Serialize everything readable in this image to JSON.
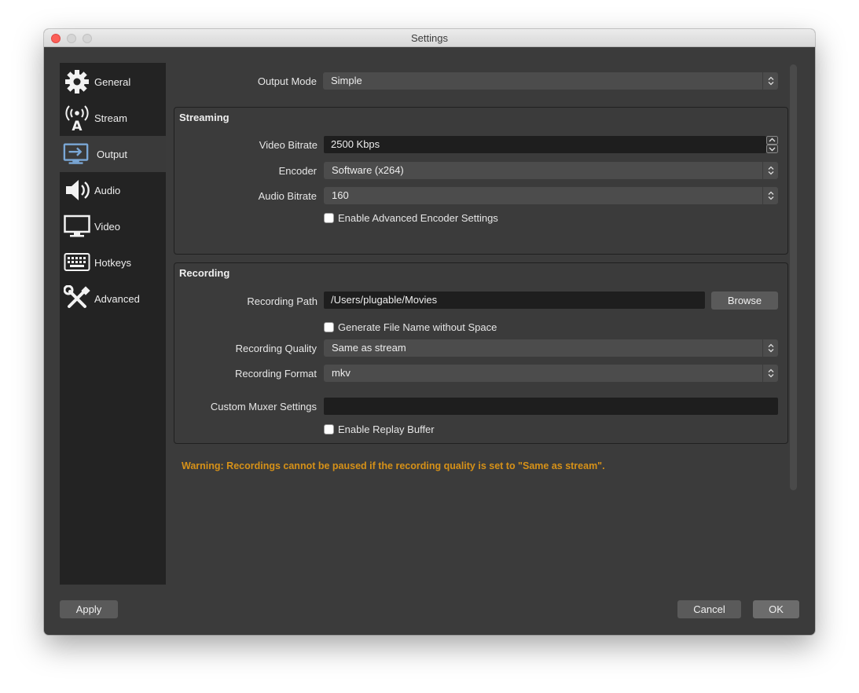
{
  "window": {
    "title": "Settings"
  },
  "sidebar": {
    "items": [
      {
        "label": "General",
        "icon": "gear-icon"
      },
      {
        "label": "Stream",
        "icon": "broadcast-icon"
      },
      {
        "label": "Output",
        "icon": "output-icon",
        "active": true
      },
      {
        "label": "Audio",
        "icon": "speaker-icon"
      },
      {
        "label": "Video",
        "icon": "monitor-icon"
      },
      {
        "label": "Hotkeys",
        "icon": "keyboard-icon"
      },
      {
        "label": "Advanced",
        "icon": "tools-icon"
      }
    ]
  },
  "output_mode": {
    "label": "Output Mode",
    "value": "Simple"
  },
  "streaming": {
    "title": "Streaming",
    "video_bitrate": {
      "label": "Video Bitrate",
      "value": "2500 Kbps"
    },
    "encoder": {
      "label": "Encoder",
      "value": "Software (x264)"
    },
    "audio_bitrate": {
      "label": "Audio Bitrate",
      "value": "160"
    },
    "advanced_encoder": {
      "label": "Enable Advanced Encoder Settings",
      "checked": false
    }
  },
  "recording": {
    "title": "Recording",
    "path": {
      "label": "Recording Path",
      "value": "/Users/plugable/Movies",
      "browse_label": "Browse"
    },
    "no_space": {
      "label": "Generate File Name without Space",
      "checked": false
    },
    "quality": {
      "label": "Recording Quality",
      "value": "Same as stream"
    },
    "format": {
      "label": "Recording Format",
      "value": "mkv"
    },
    "muxer": {
      "label": "Custom Muxer Settings",
      "value": ""
    },
    "replay_buffer": {
      "label": "Enable Replay Buffer",
      "checked": false
    }
  },
  "warning": "Warning: Recordings cannot be paused if the recording quality is set to \"Same as stream\".",
  "footer": {
    "apply_label": "Apply",
    "cancel_label": "Cancel",
    "ok_label": "OK"
  },
  "colors": {
    "window_bg": "#3b3b3b",
    "sidebar_bg": "#232323",
    "warning": "#d69118"
  }
}
